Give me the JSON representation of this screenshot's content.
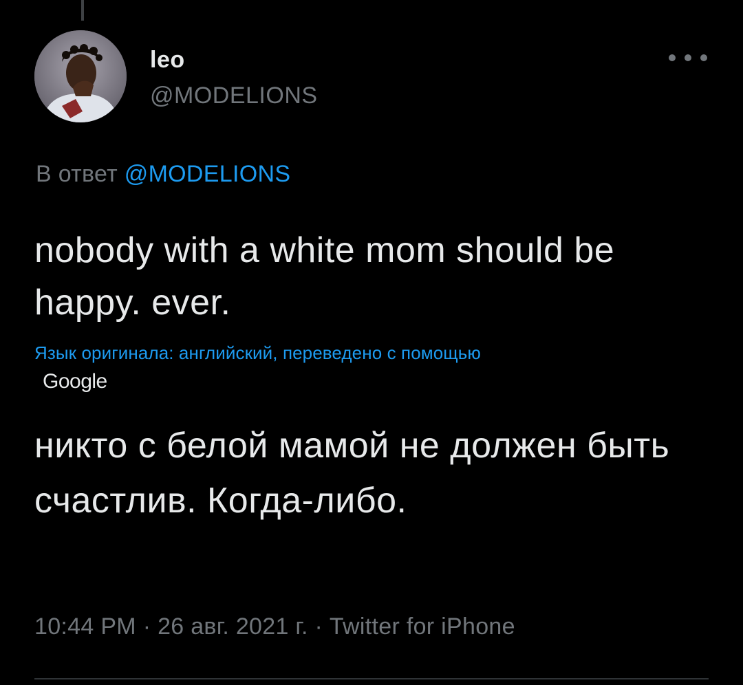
{
  "tweet": {
    "author": {
      "name": "leo",
      "handle": "@MODELIONS",
      "avatar_icon": "user-avatar"
    },
    "more_icon": "more-horizontal-icon",
    "reply_prefix": "В ответ",
    "reply_mention": "@MODELIONS",
    "text": "nobody with a white mom should be happy. ever.",
    "translation_note": "Язык оригинала: английский, переведено с помощью",
    "translation_provider": "Google",
    "translated_text": "никто с белой мамой не должен быть счастлив. Когда-либо.",
    "time": "10:44 PM",
    "date": "26 авг. 2021 г.",
    "source": "Twitter for iPhone",
    "separator": "·"
  },
  "colors": {
    "background": "#000000",
    "primary_text": "#e7e9ea",
    "secondary_text": "#71767b",
    "link": "#1d9bf0",
    "divider": "#2f3336"
  }
}
